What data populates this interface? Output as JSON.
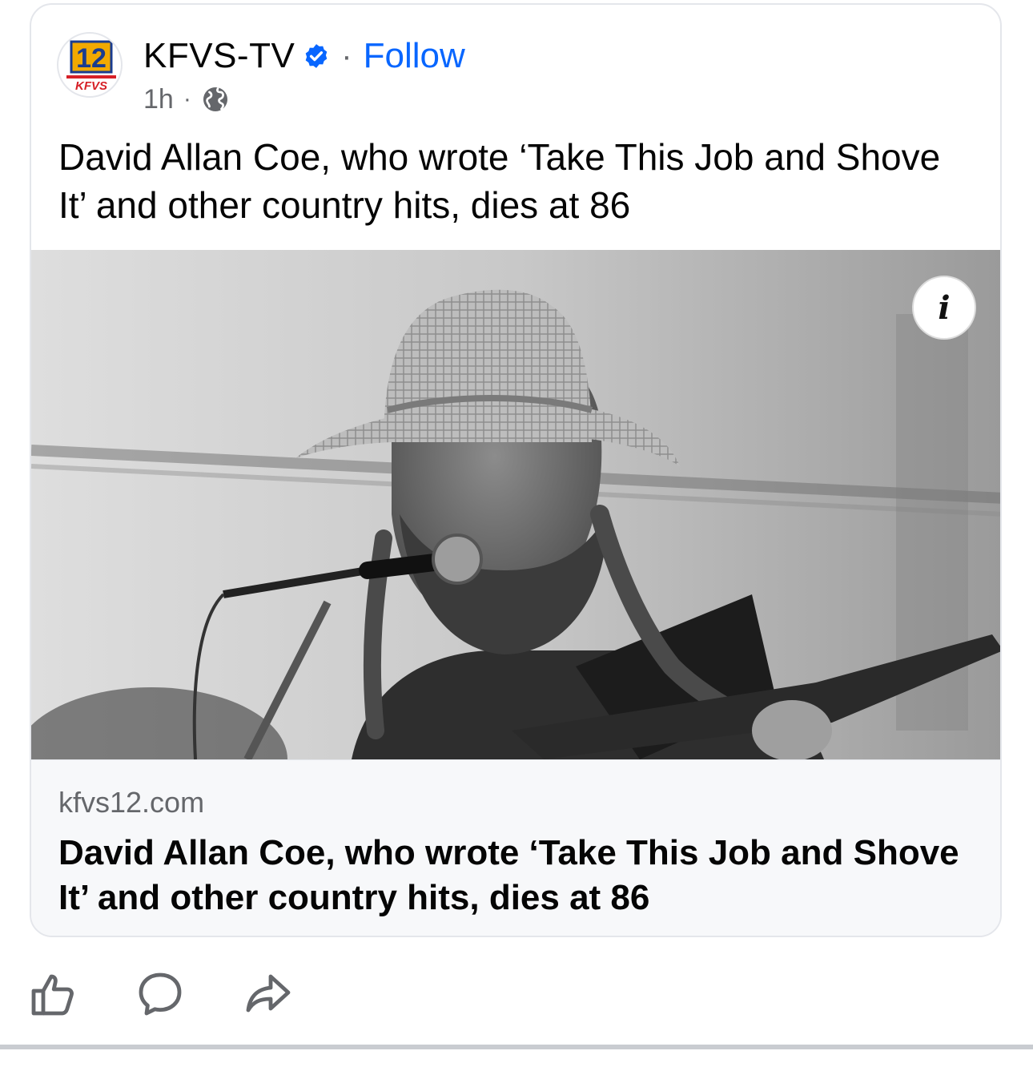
{
  "post": {
    "page_name": "KFVS-TV",
    "separator": "·",
    "follow_label": "Follow",
    "timestamp": "1h",
    "meta_separator": "·",
    "text": "David Allan Coe, who wrote ‘Take This Job and Shove It’ and other country hits, dies at 86",
    "avatar": {
      "channel_number": "12",
      "call_letters": "KFVS"
    },
    "image": {
      "info_label": "i"
    },
    "link_preview": {
      "domain": "kfvs12.com",
      "title": "David Allan Coe, who wrote ‘Take This Job and Shove It’ and other country hits, dies at 86"
    }
  },
  "actions": {
    "icons": [
      "like-icon",
      "comment-icon",
      "share-icon"
    ]
  },
  "colors": {
    "follow": "#0866ff",
    "verified": "#0866ff",
    "secondary_text": "#65676b",
    "link_area_bg": "#f7f8fa"
  }
}
